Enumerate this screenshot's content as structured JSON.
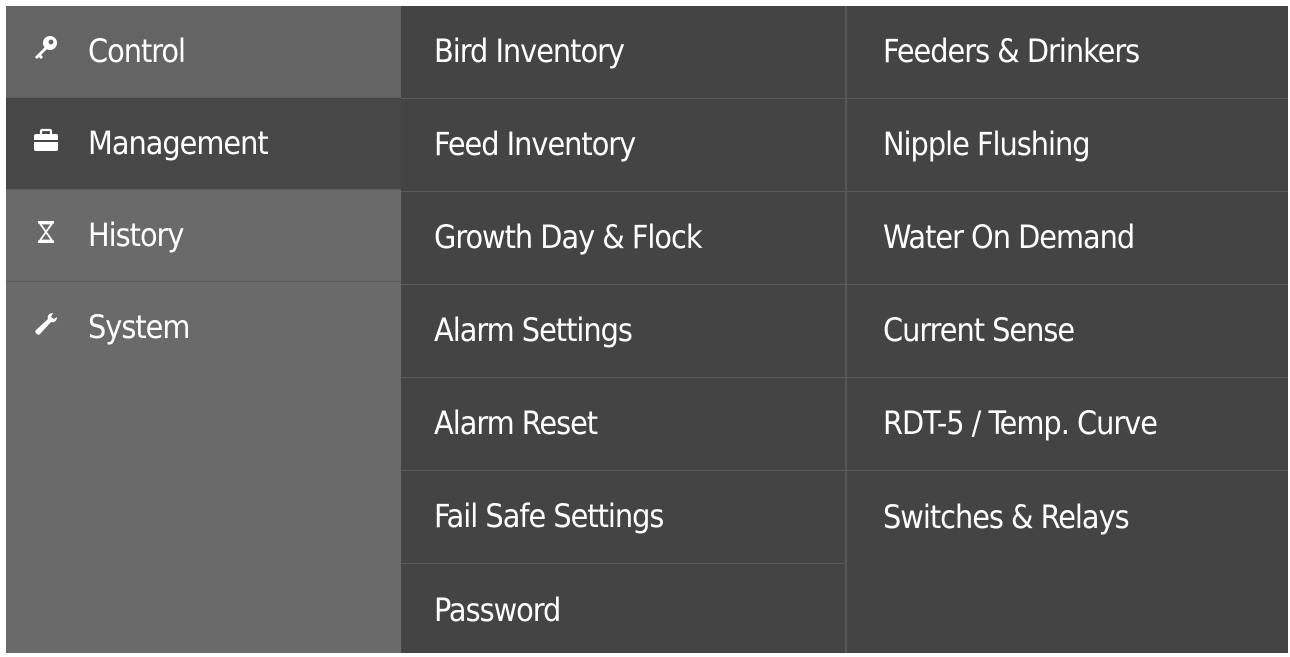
{
  "sidebar": {
    "items": [
      {
        "label": "Control",
        "icon": "key-icon"
      },
      {
        "label": "Management",
        "icon": "briefcase-icon"
      },
      {
        "label": "History",
        "icon": "hourglass-icon"
      },
      {
        "label": "System",
        "icon": "wrench-icon"
      }
    ],
    "active_index": 1
  },
  "submenu": {
    "column1": [
      "Bird Inventory",
      "Feed Inventory",
      "Growth Day & Flock",
      "Alarm Settings",
      "Alarm Reset",
      "Fail Safe Settings",
      "Password"
    ],
    "column2": [
      "Feeders & Drinkers",
      "Nipple Flushing",
      "Water On Demand",
      "Current Sense",
      "RDT-5 / Temp. Curve",
      "Switches & Relays"
    ]
  },
  "colors": {
    "sidebar_bg": "#6a6a6a",
    "active_bg": "#474747",
    "panel_bg": "#444444",
    "text": "#ffffff"
  }
}
